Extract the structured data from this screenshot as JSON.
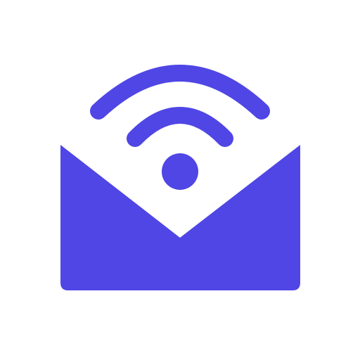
{
  "icon": {
    "name": "mail-wifi-icon",
    "accent_color": "#4F46E5",
    "background_color": "#FFFFFF"
  }
}
